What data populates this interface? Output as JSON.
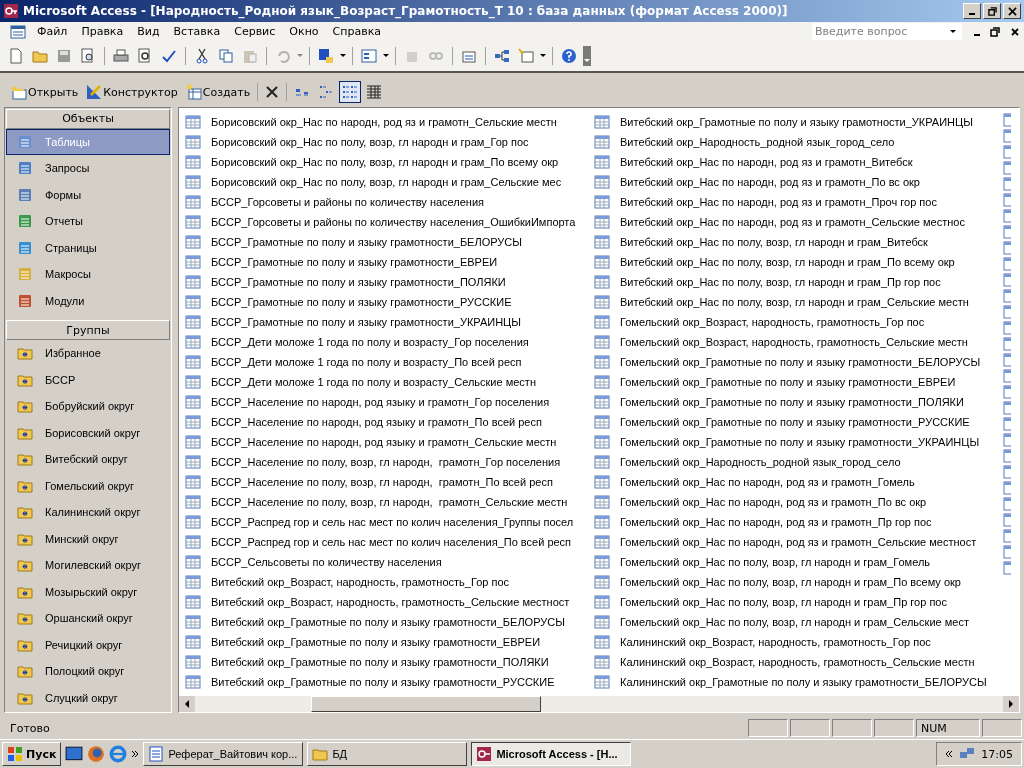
{
  "window": {
    "title": "Microsoft Access - [Народность_Родной язык_Возраст_Грамотность_Т 10 : база данных (формат Access 2000)]"
  },
  "menu": [
    "Файл",
    "Правка",
    "Вид",
    "Вставка",
    "Сервис",
    "Окно",
    "Справка"
  ],
  "help_search": {
    "placeholder": "Введите вопрос"
  },
  "db_toolbar": {
    "buttons": [
      {
        "label": "Открыть",
        "kind": "open"
      },
      {
        "label": "Конструктор",
        "kind": "design"
      },
      {
        "label": "Создать",
        "kind": "new"
      }
    ],
    "views": [
      {
        "kind": "large",
        "selected": false
      },
      {
        "kind": "small",
        "selected": false
      },
      {
        "kind": "list",
        "selected": true
      },
      {
        "kind": "details",
        "selected": false
      }
    ]
  },
  "sidebar": {
    "objects_header": "Объекты",
    "objects": [
      {
        "label": "Таблицы",
        "kind": "table",
        "selected": true
      },
      {
        "label": "Запросы",
        "kind": "query",
        "selected": false
      },
      {
        "label": "Формы",
        "kind": "form",
        "selected": false
      },
      {
        "label": "Отчеты",
        "kind": "report",
        "selected": false
      },
      {
        "label": "Страницы",
        "kind": "page",
        "selected": false
      },
      {
        "label": "Макросы",
        "kind": "macro",
        "selected": false
      },
      {
        "label": "Модули",
        "kind": "module",
        "selected": false
      }
    ],
    "groups_header": "Группы",
    "groups": [
      "Избранное",
      "БССР",
      "Бобруйский округ",
      "Борисовский округ",
      "Витебский округ",
      "Гомельский округ",
      "Калининский округ",
      "Минский округ",
      "Могилевский округ",
      "Мозырьский округ",
      "Оршанский округ",
      "Речицкий округ",
      "Полоцкий округ",
      "Слуцкий округ"
    ]
  },
  "tables": [
    [
      "Борисовский окр_Нас по народн, род яз и грамотн_Сельские местн",
      "Борисовский окр_Нас по полу, возр, гл народн и грам_Гор пос",
      "Борисовский окр_Нас по полу, возр, гл народн и грам_По всему окр",
      "Борисовский окр_Нас по полу, возр, гл народн и грам_Сельские мес",
      "БССР_Горсоветы и районы по количеству населения",
      "БССР_Горсоветы и районы по количеству населения_ОшибкиИмпорта",
      "БССР_Грамотные по полу и языку грамотности_БЕЛОРУСЫ",
      "БССР_Грамотные по полу и языку грамотности_ЕВРЕИ",
      "БССР_Грамотные по полу и языку грамотности_ПОЛЯКИ",
      "БССР_Грамотные по полу и языку грамотности_РУССКИЕ",
      "БССР_Грамотные по полу и языку грамотности_УКРАИНЦЫ",
      "БССР_Дети моложе 1 года по полу и возрасту_Гор поселения",
      "БССР_Дети моложе 1 года по полу и возрасту_По всей респ",
      "БССР_Дети моложе 1 года по полу и возрасту_Сельские местн",
      "БССР_Население по народн, род языку и грамотн_Гор поселения",
      "БССР_Население по народн, род языку и грамотн_По всей респ",
      "БССР_Население по народн, род языку и грамотн_Сельские местн",
      "БССР_Население по полу, возр, гл народн,  грамотн_Гор поселения",
      "БССР_Население по полу, возр, гл народн,  грамотн_По всей респ",
      "БССР_Население по полу, возр, гл народн,  грамотн_Сельские местн",
      "БССР_Распред гор и сель нас мест по колич населения_Группы посел",
      "БССР_Распред гор и сель нас мест по колич населения_По всей респ",
      "БССР_Сельсоветы по количеству населения",
      "Витебский окр_Возраст, народность, грамотность_Гор пос",
      "Витебский окр_Возраст, народность, грамотность_Сельские местност",
      "Витебский окр_Грамотные по полу и языку грамотности_БЕЛОРУСЫ",
      "Витебский окр_Грамотные по полу и языку грамотности_ЕВРЕИ",
      "Витебский окр_Грамотные по полу и языку грамотности_ПОЛЯКИ",
      "Витебский окр_Грамотные по полу и языку грамотности_РУССКИЕ"
    ],
    [
      "Витебский окр_Грамотные по полу и языку грамотности_УКРАИНЦЫ",
      "Витебский окр_Народность_родной язык_город_село",
      "Витебский окр_Нас по народн, род яз и грамотн_Витебск",
      "Витебский окр_Нас по народн, род яз и грамотн_По вс окр",
      "Витебский окр_Нас по народн, род яз и грамотн_Проч гор пос",
      "Витебский окр_Нас по народн, род яз и грамотн_Сельские местнос",
      "Витебский окр_Нас по полу, возр, гл народн и грам_Витебск",
      "Витебский окр_Нас по полу, возр, гл народн и грам_По всему окр",
      "Витебский окр_Нас по полу, возр, гл народн и грам_Пр гор пос",
      "Витебский окр_Нас по полу, возр, гл народн и грам_Сельские местн",
      "Гомельский окр_Возраст, народность, грамотность_Гор пос",
      "Гомельский окр_Возраст, народность, грамотность_Сельские местн",
      "Гомельский окр_Грамотные по полу и языку грамотности_БЕЛОРУСЫ",
      "Гомельский окр_Грамотные по полу и языку грамотности_ЕВРЕИ",
      "Гомельский окр_Грамотные по полу и языку грамотности_ПОЛЯКИ",
      "Гомельский окр_Грамотные по полу и языку грамотности_РУССКИЕ",
      "Гомельский окр_Грамотные по полу и языку грамотности_УКРАИНЦЫ",
      "Гомельский окр_Народность_родной язык_город_село",
      "Гомельский окр_Нас по народн, род яз и грамотн_Гомель",
      "Гомельский окр_Нас по народн, род яз и грамотн_По вс окр",
      "Гомельский окр_Нас по народн, род яз и грамотн_Пр гор пос",
      "Гомельский окр_Нас по народн, род яз и грамотн_Сельские местност",
      "Гомельский окр_Нас по полу, возр, гл народн и грам_Гомель",
      "Гомельский окр_Нас по полу, возр, гл народн и грам_По всему окр",
      "Гомельский окр_Нас по полу, возр, гл народн и грам_Пр гор пос",
      "Гомельский окр_Нас по полу, возр, гл народн и грам_Сельские мест",
      "Калининский окр_Возраст, народность, грамотность_Гор пос",
      "Калининский окр_Возраст, народность, грамотность_Сельские местн",
      "Калининский окр_Грамотные по полу и языку грамотности_БЕЛОРУСЫ"
    ]
  ],
  "status_bar": {
    "text": "Готово",
    "indicator": "NUM"
  },
  "taskbar": {
    "start": "Пуск",
    "tasks": [
      {
        "label": "Реферат_Вайтович кор...",
        "kind": "word",
        "selected": false
      },
      {
        "label": "БД",
        "kind": "folder",
        "selected": false
      },
      {
        "label": "Microsoft Access - [Н...",
        "kind": "access",
        "selected": true
      }
    ],
    "clock": "17:05"
  }
}
